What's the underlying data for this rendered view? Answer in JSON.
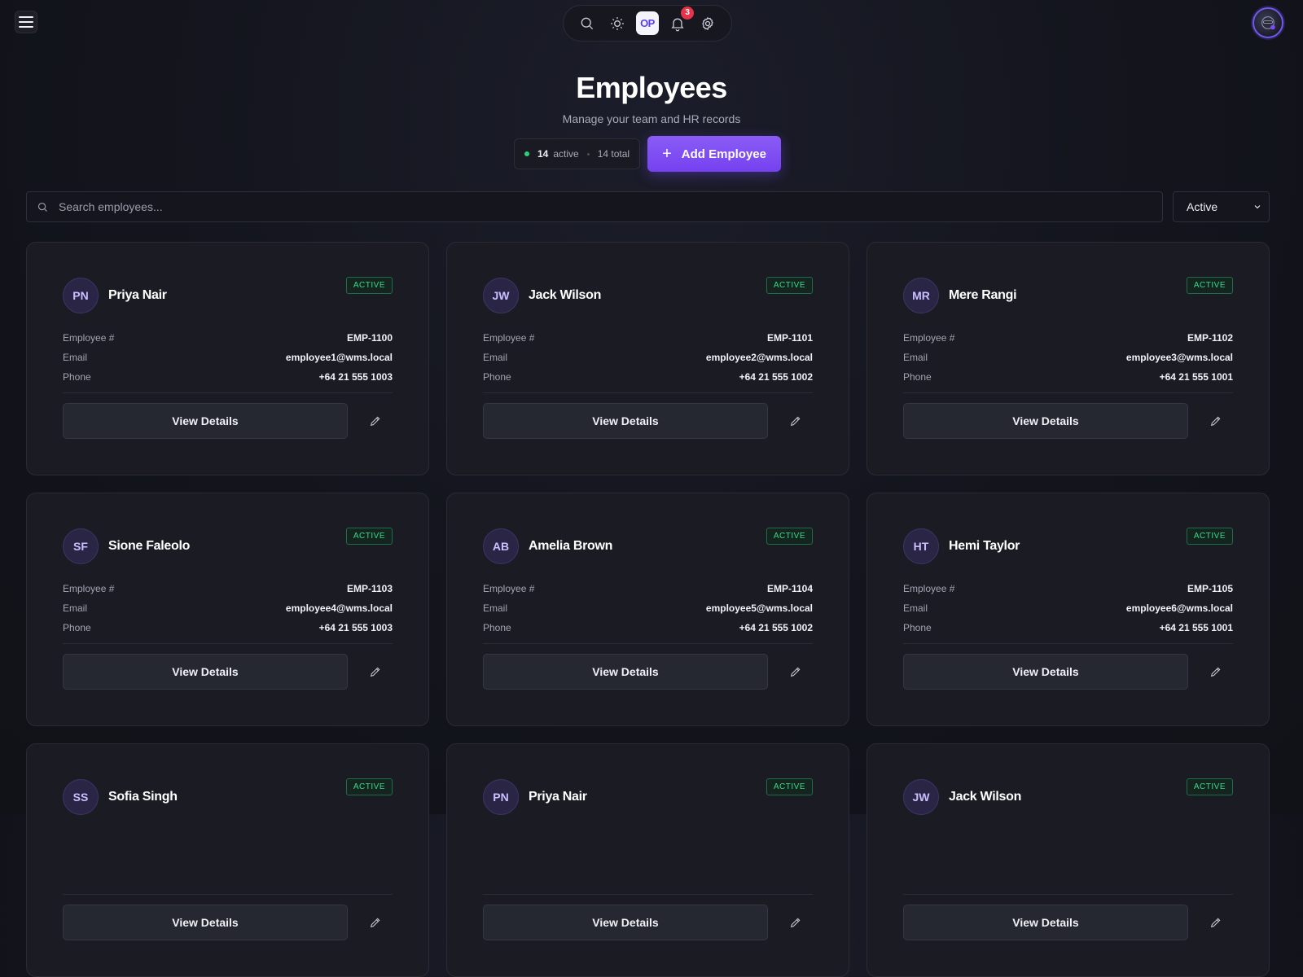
{
  "toolbar": {
    "icons": [
      "search-icon",
      "sun-icon",
      "op-logo",
      "bell-icon",
      "gear-icon"
    ],
    "logo_text": "OP",
    "notification_count": "3"
  },
  "header": {
    "title": "Employees",
    "subtitle": "Manage your team and HR records",
    "active_count": "14",
    "active_label": "active",
    "total_label": "14 total",
    "add_button_label": "Add Employee"
  },
  "filters": {
    "search_placeholder": "Search employees...",
    "status_selected": "Active"
  },
  "labels": {
    "employee_number": "Employee #",
    "email": "Email",
    "phone": "Phone",
    "view_details": "View Details"
  },
  "colors": {
    "accent": "#7c4dff",
    "status_active": "#3ad98a",
    "badge_red": "#e5334b"
  },
  "employees": [
    {
      "initials": "PN",
      "name": "Priya Nair",
      "status": "ACTIVE",
      "employee_number": "EMP-1100",
      "email": "employee1@wms.local",
      "phone": "+64 21 555 1003"
    },
    {
      "initials": "JW",
      "name": "Jack Wilson",
      "status": "ACTIVE",
      "employee_number": "EMP-1101",
      "email": "employee2@wms.local",
      "phone": "+64 21 555 1002"
    },
    {
      "initials": "MR",
      "name": "Mere Rangi",
      "status": "ACTIVE",
      "employee_number": "EMP-1102",
      "email": "employee3@wms.local",
      "phone": "+64 21 555 1001"
    },
    {
      "initials": "SF",
      "name": "Sione Faleolo",
      "status": "ACTIVE",
      "employee_number": "EMP-1103",
      "email": "employee4@wms.local",
      "phone": "+64 21 555 1003"
    },
    {
      "initials": "AB",
      "name": "Amelia Brown",
      "status": "ACTIVE",
      "employee_number": "EMP-1104",
      "email": "employee5@wms.local",
      "phone": "+64 21 555 1002"
    },
    {
      "initials": "HT",
      "name": "Hemi Taylor",
      "status": "ACTIVE",
      "employee_number": "EMP-1105",
      "email": "employee6@wms.local",
      "phone": "+64 21 555 1001"
    },
    {
      "initials": "SS",
      "name": "Sofia Singh",
      "status": "ACTIVE"
    },
    {
      "initials": "PN",
      "name": "Priya Nair",
      "status": "ACTIVE"
    },
    {
      "initials": "JW",
      "name": "Jack Wilson",
      "status": "ACTIVE"
    }
  ]
}
